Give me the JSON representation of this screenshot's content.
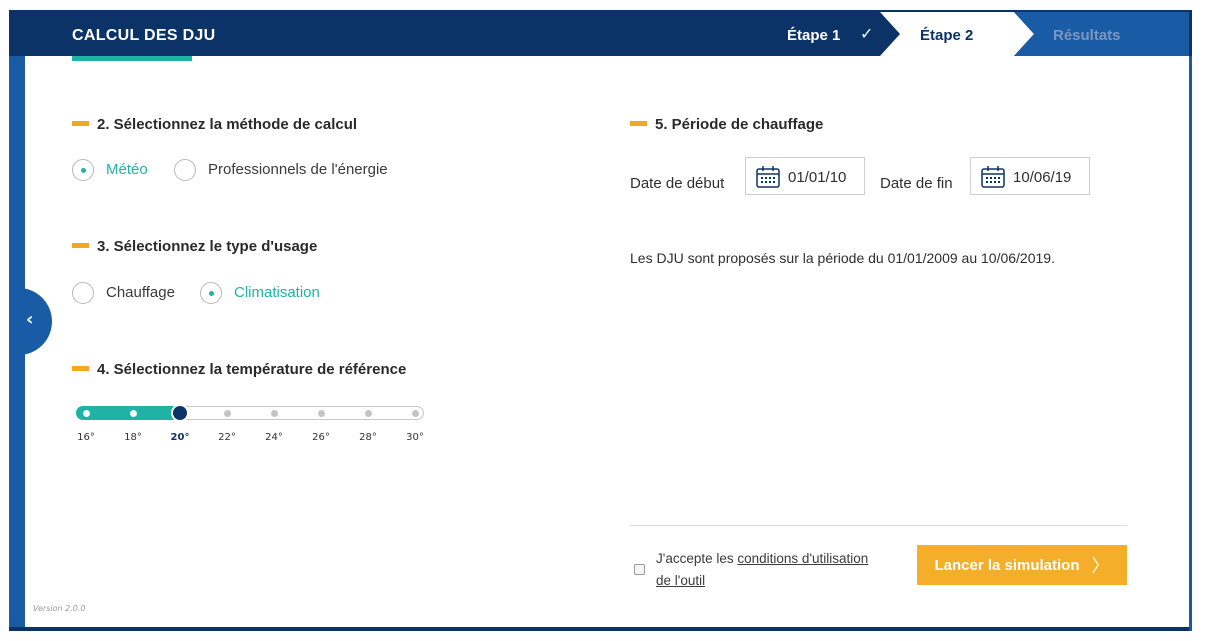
{
  "header": {
    "title": "CALCUL DES DJU",
    "steps": [
      {
        "label": "Étape 1",
        "state": "done"
      },
      {
        "label": "Étape 2",
        "state": "active"
      },
      {
        "label": "Résultats",
        "state": "upcoming"
      }
    ]
  },
  "sections": {
    "method": {
      "title": "2. Sélectionnez la méthode de calcul",
      "options": [
        {
          "label": "Météo",
          "selected": true
        },
        {
          "label": "Professionnels de l'énergie",
          "selected": false
        }
      ]
    },
    "usage": {
      "title": "3. Sélectionnez le type d'usage",
      "options": [
        {
          "label": "Chauffage",
          "selected": false
        },
        {
          "label": "Climatisation",
          "selected": true
        }
      ]
    },
    "temperature": {
      "title": "4. Sélectionnez la température de référence",
      "ticks": [
        "16°",
        "18°",
        "20°",
        "22°",
        "24°",
        "26°",
        "28°",
        "30°"
      ],
      "selected_index": 2
    },
    "period": {
      "title": "5. Période de chauffage",
      "start_label": "Date de début",
      "start_value": "01/01/10",
      "end_label": "Date de fin",
      "end_value": "10/06/19",
      "info": "Les DJU sont proposés sur la période du 01/01/2009 au 10/06/2019."
    }
  },
  "footer": {
    "accept_prefix": "J'accepte les",
    "accept_link_line1": "conditions d'utilisation",
    "accept_link_line2": "de l'outil",
    "submit_label": "Lancer la simulation",
    "version": "Version 2.0.0"
  },
  "colors": {
    "navy": "#0c3368",
    "blue": "#1a5ba6",
    "teal": "#1fb3a5",
    "orange": "#f5ae2a"
  }
}
